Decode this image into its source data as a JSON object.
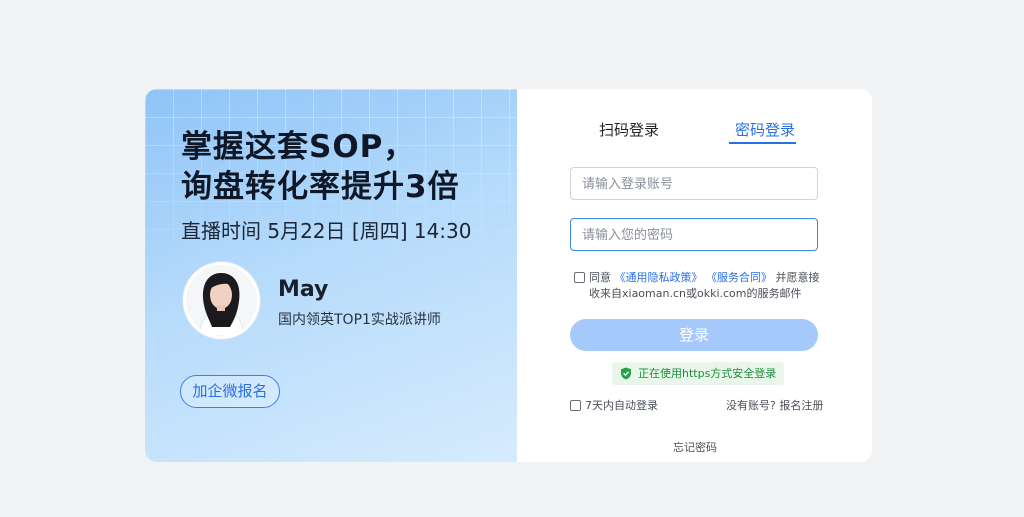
{
  "banner": {
    "headline_line1": "掌握这套SOP，",
    "headline_line2": "询盘转化率提升3倍",
    "live_time": "直播时间 5月22日 [周四] 14:30",
    "speaker_name": "May",
    "speaker_title": "国内领英TOP1实战派讲师",
    "signup_button": "加企微报名"
  },
  "login": {
    "tabs": [
      {
        "label": "扫码登录",
        "active": false
      },
      {
        "label": "密码登录",
        "active": true
      }
    ],
    "account_placeholder": "请输入登录账号",
    "password_placeholder": "请输入您的密码",
    "agreement": {
      "prefix": "同意",
      "privacy_link": "《通用隐私政策》",
      "service_link": "《服务合同》",
      "suffix": "并愿意接",
      "line2": "收来自xiaoman.cn或okki.com的服务邮件"
    },
    "login_button": "登录",
    "secure_notice": "正在使用https方式安全登录",
    "remember_label": "7天内自动登录",
    "register_link": "没有账号? 报名注册",
    "forgot_link": "忘记密码"
  },
  "colors": {
    "accent": "#2b6fe6",
    "login_button_bg": "#a6c9fb",
    "secure_green": "#1e8c3a",
    "page_bg": "#f2f3f5"
  }
}
